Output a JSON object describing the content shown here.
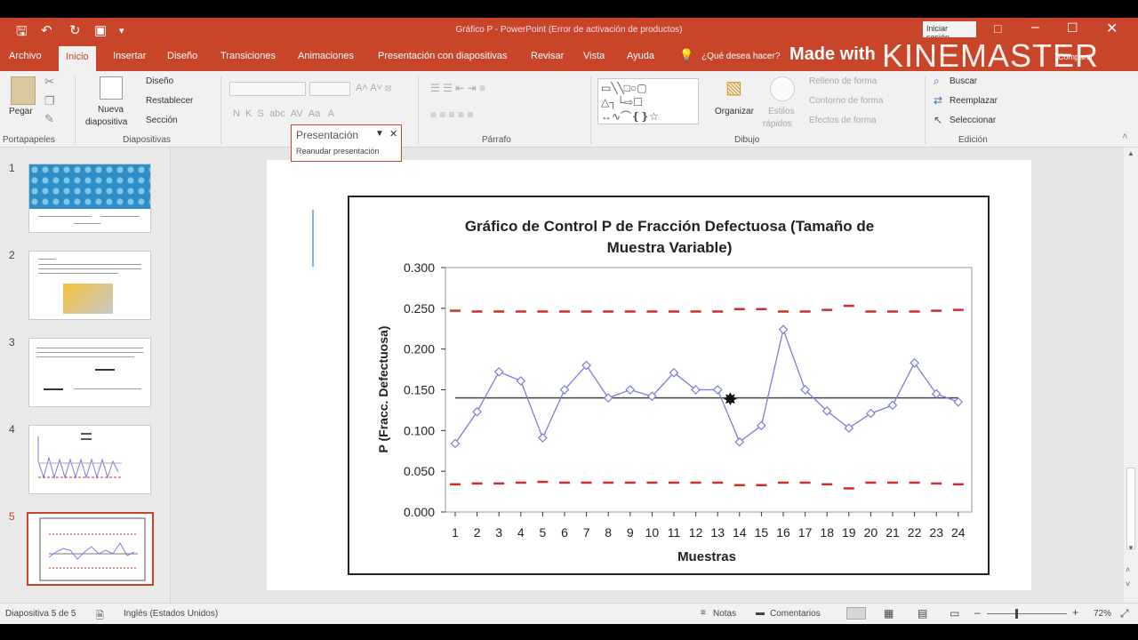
{
  "window": {
    "title": "Gráfico P  -  PowerPoint (Error de activación de productos)",
    "signin_label": "Iniciar sesión"
  },
  "watermark": {
    "made_with": "Made with",
    "brand": "KINEMASTER"
  },
  "tabs": [
    "Archivo",
    "Inicio",
    "Insertar",
    "Diseño",
    "Transiciones",
    "Animaciones",
    "Presentación con diapositivas",
    "Revisar",
    "Vista",
    "Ayuda"
  ],
  "tell_me": "¿Qué desea hacer?",
  "share": "Compartir",
  "ribbon": {
    "paste": "Pegar",
    "clipboard_group": "Portapapeles",
    "new_slide_l1": "Nueva",
    "new_slide_l2": "diapositiva",
    "layout": "Diseño",
    "reset": "Restablecer",
    "section": "Sección",
    "slides_group": "Diapositivas",
    "presentation_box_title": "Presentación",
    "presentation_box_sub": "Reanudar presentación",
    "paragraph_group": "Párrafo",
    "arrange": "Organizar",
    "quick_styles_l1": "Estilos",
    "quick_styles_l2": "rápidos",
    "shape_fill": "Relleno de forma",
    "shape_outline": "Contorno de forma",
    "shape_effects": "Efectos de forma",
    "drawing_group": "Dibujo",
    "find": "Buscar",
    "replace": "Reemplazar",
    "select": "Seleccionar",
    "editing_group": "Edición"
  },
  "slides": {
    "numbers": [
      "1",
      "2",
      "3",
      "4",
      "5"
    ],
    "active_index": 5
  },
  "status": {
    "slide_info": "Diapositiva 5 de 5",
    "language": "Inglés (Estados Unidos)",
    "notes": "Notas",
    "comments": "Comentarios",
    "zoom": "72%"
  },
  "colors": {
    "accent": "#c8452a",
    "series": "#7b7bdc",
    "limits": "#d22b2b",
    "center": "#444444"
  },
  "chart_data": {
    "type": "line",
    "title_line1": "Gráfico de Control P de Fracción Defectuosa (Tamaño de",
    "title_line2": "Muestra Variable)",
    "xlabel": "Muestras",
    "ylabel": "P (Fracc. Defectuosa)",
    "ylim": [
      0,
      0.3
    ],
    "yticks": [
      "0.000",
      "0.050",
      "0.100",
      "0.150",
      "0.200",
      "0.250",
      "0.300"
    ],
    "x": [
      "1",
      "2",
      "3",
      "4",
      "5",
      "6",
      "7",
      "8",
      "9",
      "10",
      "11",
      "12",
      "13",
      "14",
      "15",
      "16",
      "17",
      "18",
      "19",
      "20",
      "21",
      "22",
      "23",
      "24"
    ],
    "series": [
      {
        "values": [
          0.084,
          0.123,
          0.172,
          0.161,
          0.091,
          0.15,
          0.18,
          0.14,
          0.15,
          0.142,
          0.171,
          0.15,
          0.15,
          0.086,
          0.106,
          0.224,
          0.15,
          0.124,
          0.103,
          0.121,
          0.131,
          0.183,
          0.145,
          0.135
        ]
      }
    ],
    "center_line": 0.14,
    "ucl": [
      0.247,
      0.246,
      0.246,
      0.246,
      0.246,
      0.246,
      0.246,
      0.246,
      0.246,
      0.246,
      0.246,
      0.246,
      0.246,
      0.249,
      0.249,
      0.246,
      0.246,
      0.248,
      0.253,
      0.246,
      0.246,
      0.246,
      0.247,
      0.248
    ],
    "lcl": [
      0.034,
      0.035,
      0.035,
      0.036,
      0.037,
      0.036,
      0.036,
      0.036,
      0.036,
      0.036,
      0.036,
      0.036,
      0.036,
      0.033,
      0.033,
      0.036,
      0.036,
      0.034,
      0.029,
      0.036,
      0.036,
      0.036,
      0.035,
      0.034
    ],
    "grid": false,
    "legend": "none"
  }
}
